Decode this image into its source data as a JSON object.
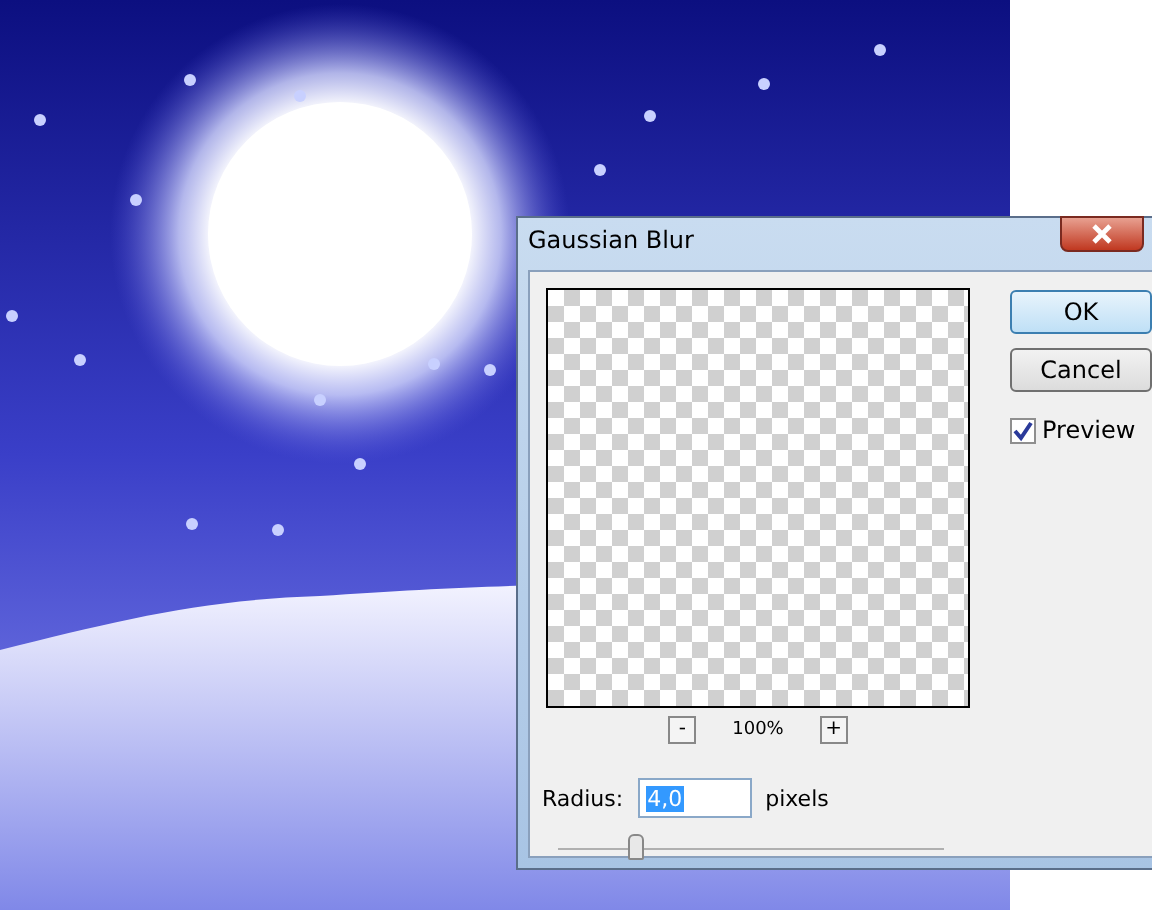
{
  "dialog": {
    "title": "Gaussian Blur"
  },
  "buttons": [
    {
      "label": "OK",
      "kind": "default"
    },
    {
      "label": "Cancel",
      "kind": "normal"
    }
  ],
  "preview": {
    "label": "Preview",
    "checked": true
  },
  "zoom": {
    "minus": "-",
    "percent": "100%",
    "plus": "+"
  },
  "radius": {
    "label": "Radius:",
    "value": "4,0",
    "selected": true,
    "unit": "pixels"
  },
  "slider": {
    "level": 0.2
  }
}
